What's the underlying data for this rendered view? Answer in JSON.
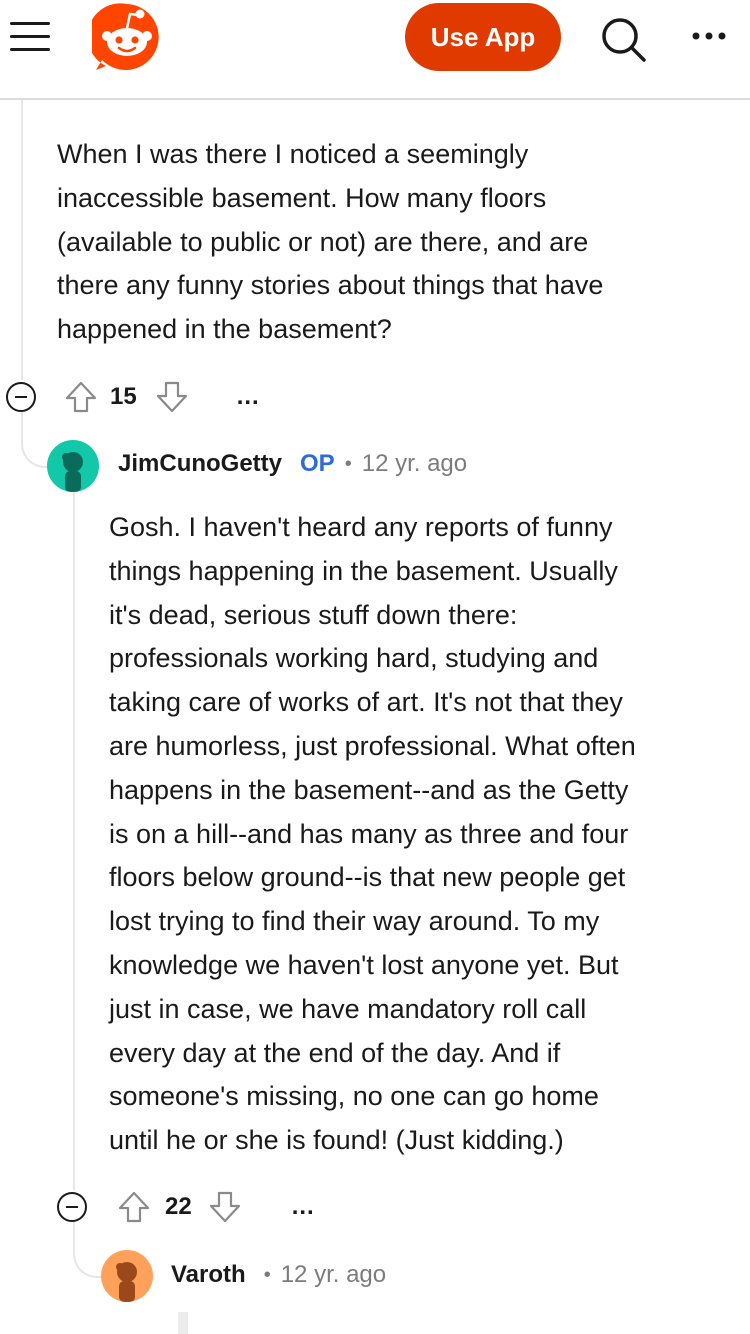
{
  "header": {
    "menu_icon": "hamburger-menu-icon",
    "logo_icon": "reddit-snoo-logo",
    "use_app_label": "Use App",
    "search_icon": "search-icon",
    "more_icon": "more-dots-icon",
    "brand_color": "#ff4500",
    "button_color": "#e03a00"
  },
  "parent_comment": {
    "body": "When I was there I noticed a seemingly\ninaccessible basement. How many floors\n(available to public or not) are there, and are\nthere any funny stories about things that have\nhappened in the basement?",
    "votes": "15",
    "more_label": "..."
  },
  "reply": {
    "username": "JimCunoGetty",
    "badge": "OP",
    "separator": "•",
    "time": "12 yr. ago",
    "avatar_color": "#12c8a8",
    "body": "Gosh. I haven't heard any reports of funny\nthings happening in the basement. Usually\nit's dead, serious stuff down there:\nprofessionals working hard, studying and\ntaking care of works of art. It's not that they\nare humorless, just professional. What often\nhappens in the basement--and as the Getty\nis on a hill--and has many as three and four\nfloors below ground--is that new people get\nlost trying to find their way around. To my\nknowledge we haven't lost anyone yet. But\njust in case, we have mandatory roll call\nevery day at the end of the day. And if\nsomeone's missing, no one can go home\nuntil he or she is found! (Just kidding.)",
    "votes": "22",
    "more_label": "..."
  },
  "next_reply": {
    "username": "Varoth",
    "separator": "•",
    "time": "12 yr. ago",
    "avatar_color": "#ffa15a"
  }
}
